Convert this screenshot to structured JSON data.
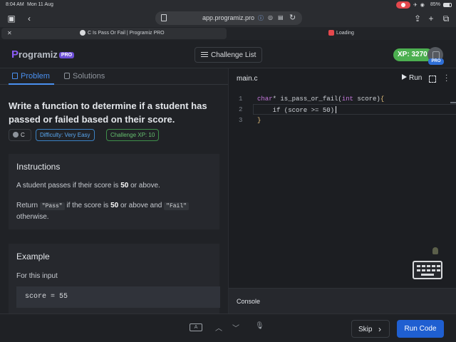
{
  "status": {
    "time": "8:04 AM",
    "date": "Mon 11 Aug",
    "battery": "85%"
  },
  "browser": {
    "url": "app.programiz.pro"
  },
  "tabs": [
    {
      "title": "C Is Pass Or Fail | Programiz PRO"
    },
    {
      "title": "Loading"
    }
  ],
  "header": {
    "logo_text": "rogramiz",
    "logo_letter": "P",
    "logo_badge": "PRO",
    "challenge_list": "Challenge List",
    "xp": "XP: 3270",
    "pro_badge": "PRO"
  },
  "left": {
    "tab_problem": "Problem",
    "tab_solutions": "Solutions",
    "title": "Write a function to determine if a student has passed or failed based on their score.",
    "chips": {
      "lang": "C",
      "difficulty": "Difficulty: Very Easy",
      "xp": "Challenge XP: 10"
    },
    "instructions": {
      "heading": "Instructions",
      "p1_a": "A student passes if their score is ",
      "p1_b": "50",
      "p1_c": " or above.",
      "p2_a": "Return ",
      "p2_pass": "\"Pass\"",
      "p2_b": " if the score is ",
      "p2_c": "50",
      "p2_d": " or above and ",
      "p2_fail": "\"Fail\"",
      "p2_e": "otherwise."
    },
    "example": {
      "heading": "Example",
      "subheading": "For this input",
      "input": "score = 55"
    }
  },
  "editor": {
    "filename": "main.c",
    "run": "Run",
    "line_numbers": [
      "1",
      "2",
      "3"
    ],
    "line1_type": "char",
    "line1_rest": "* is_pass_or_fail(",
    "line1_int": "int",
    "line1_end": " score)",
    "line1_brace": "{",
    "line2": "    if (score >= 50)",
    "line3": "}",
    "console": "Console"
  },
  "bottom": {
    "key_a": "A",
    "skip": "Skip",
    "run_code": "Run Code"
  },
  "colors": {
    "accent": "#1f5fd1",
    "xp_green": "#4caf50",
    "tab_blue": "#4a90f0"
  }
}
